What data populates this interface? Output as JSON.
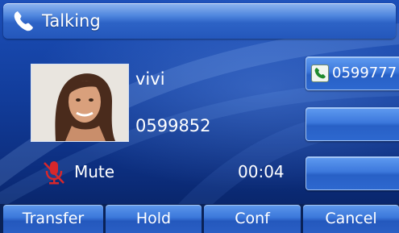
{
  "colors": {
    "accent": "#2d63c6",
    "background": "#123d9c",
    "text": "#ffffff",
    "mute_icon": "#d7272b",
    "line_icon": "#1f8a2e"
  },
  "header": {
    "title": "Talking",
    "icon": "handset-icon"
  },
  "caller": {
    "name": "vivi",
    "number": "0599852",
    "photo": "caller-photo"
  },
  "status": {
    "mute_label": "Mute",
    "mute_icon": "muted-microphone-icon",
    "duration": "00:04"
  },
  "line_keys": [
    {
      "label": "0599777",
      "icon": "phone-icon"
    },
    {
      "label": ""
    },
    {
      "label": ""
    }
  ],
  "softkeys": [
    {
      "label": "Transfer"
    },
    {
      "label": "Hold"
    },
    {
      "label": "Conf"
    },
    {
      "label": "Cancel"
    }
  ]
}
